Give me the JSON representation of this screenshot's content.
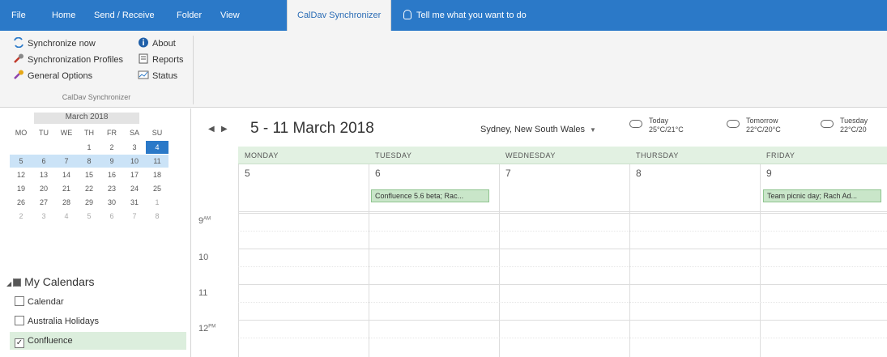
{
  "tabs": [
    "File",
    "Home",
    "Send / Receive",
    "Folder",
    "View",
    "CalDav Synchronizer"
  ],
  "tell_me": "Tell me what you want to do",
  "ribbon": {
    "synchronize_now": "Synchronize now",
    "about": "About",
    "sync_profiles": "Synchronization Profiles",
    "reports": "Reports",
    "general_options": "General Options",
    "status": "Status",
    "group_label": "CalDav Synchronizer"
  },
  "mini_calendar": {
    "title": "March 2018",
    "dow": [
      "MO",
      "TU",
      "WE",
      "TH",
      "FR",
      "SA",
      "SU"
    ],
    "weeks": [
      [
        "",
        "",
        "",
        "1",
        "2",
        "3",
        "4"
      ],
      [
        "5",
        "6",
        "7",
        "8",
        "9",
        "10",
        "11"
      ],
      [
        "12",
        "13",
        "14",
        "15",
        "16",
        "17",
        "18"
      ],
      [
        "19",
        "20",
        "21",
        "22",
        "23",
        "24",
        "25"
      ],
      [
        "26",
        "27",
        "28",
        "29",
        "30",
        "31",
        "1"
      ],
      [
        "2",
        "3",
        "4",
        "5",
        "6",
        "7",
        "8"
      ]
    ]
  },
  "calendars": {
    "header": "My Calendars",
    "items": [
      {
        "label": "Calendar",
        "checked": false
      },
      {
        "label": "Australia Holidays",
        "checked": false
      },
      {
        "label": "Confluence",
        "checked": true
      }
    ]
  },
  "main": {
    "date_range": "5 - 11 March 2018",
    "location": "Sydney, New South Wales",
    "weather": [
      {
        "day": "Today",
        "temp": "25°C/21°C",
        "icon": "cloud-icon"
      },
      {
        "day": "Tomorrow",
        "temp": "22°C/20°C",
        "icon": "rain-cloud-icon"
      },
      {
        "day": "Tuesday",
        "temp": "22°C/20",
        "icon": "rain-cloud-icon"
      }
    ],
    "days": [
      {
        "name": "MONDAY",
        "num": "5"
      },
      {
        "name": "TUESDAY",
        "num": "6"
      },
      {
        "name": "WEDNESDAY",
        "num": "7"
      },
      {
        "name": "THURSDAY",
        "num": "8"
      },
      {
        "name": "FRIDAY",
        "num": "9"
      }
    ],
    "events": [
      {
        "text": "Confluence 5.6 beta; Rac..."
      },
      {
        "text": "Team picnic day; Rach Ad..."
      }
    ],
    "hours": [
      "9",
      "10",
      "11",
      "12"
    ],
    "hour_suffix_am": "AM",
    "hour_suffix_pm": "PM"
  }
}
